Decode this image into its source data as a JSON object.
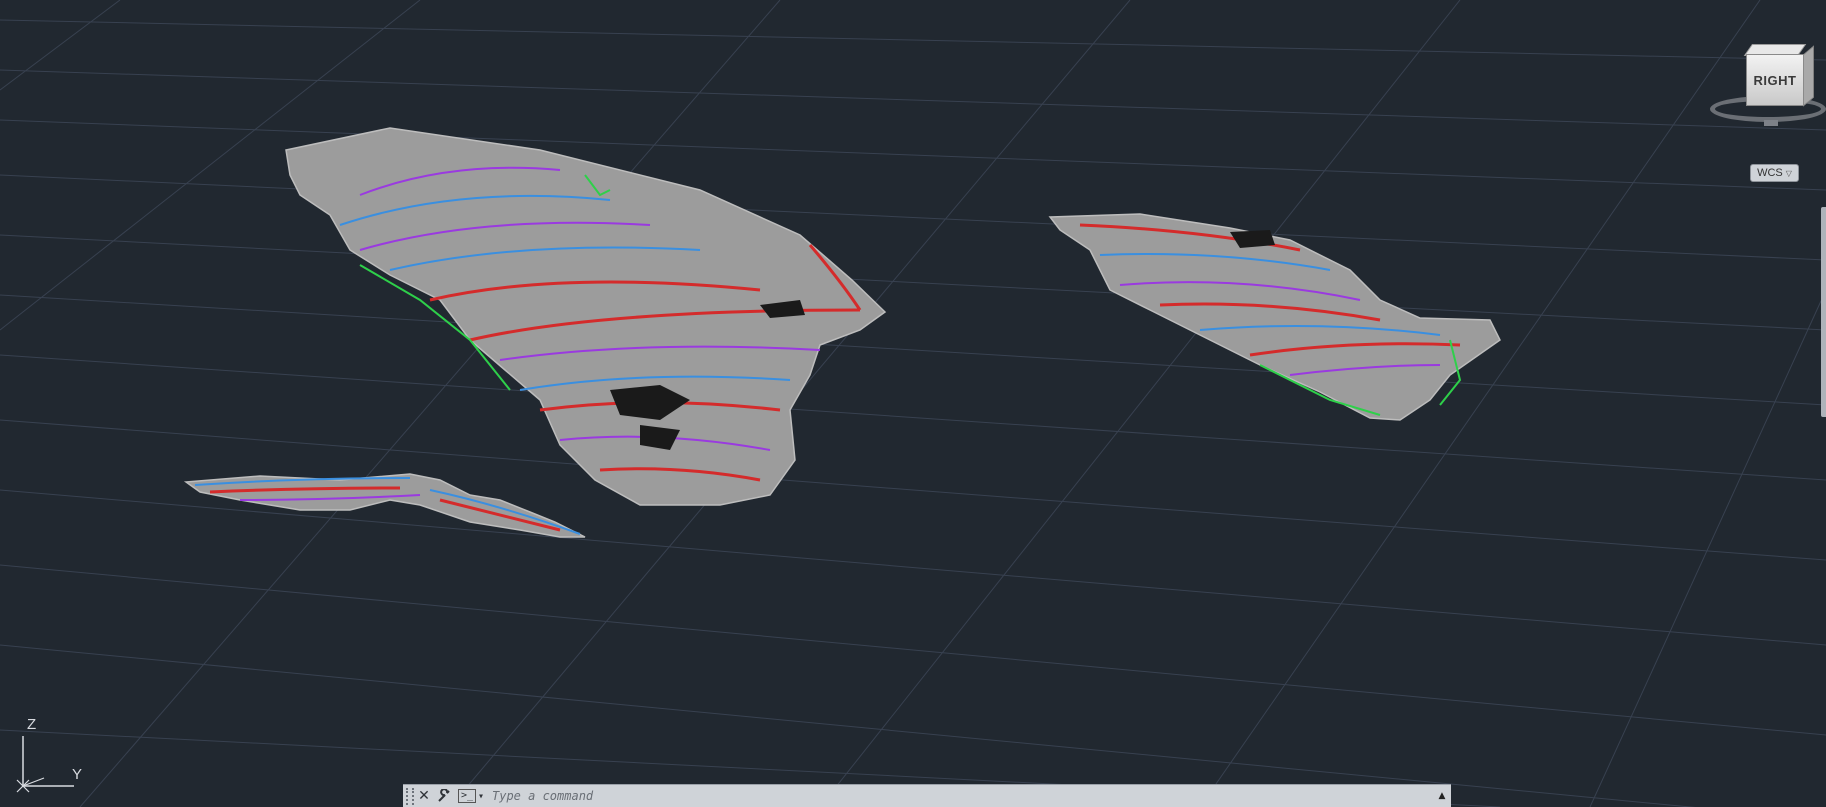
{
  "viewcube": {
    "face_label": "RIGHT",
    "wcs_label": "WCS",
    "wcs_chevron": "▽"
  },
  "ucs": {
    "z_label": "Z",
    "y_label": "Y"
  },
  "command_line": {
    "close_icon": "close-icon",
    "customize_icon": "wrench-icon",
    "prompt_icon": ">_",
    "placeholder": "Type a command",
    "history_icon": "▲"
  },
  "colors": {
    "background": "#212830",
    "grid": "#3a4350",
    "terrain": "#9c9c9c",
    "contour_red": "#d42b2b",
    "contour_blue": "#3a8fe0",
    "contour_purple": "#9a3ae0",
    "contour_green": "#2ed04a"
  }
}
